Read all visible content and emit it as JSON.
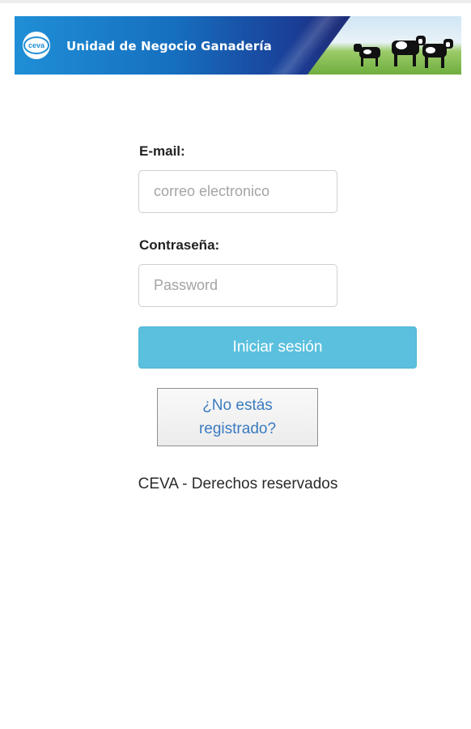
{
  "header": {
    "logo_text": "ceva",
    "title": "Unidad de Negocio Ganadería"
  },
  "form": {
    "email_label": "E-mail:",
    "email_placeholder": "correo electronico",
    "email_value": "",
    "password_label": "Contraseña:",
    "password_placeholder": "Password",
    "password_value": "",
    "login_button": "Iniciar sesión",
    "register_line1": "¿No estás",
    "register_line2": "registrado?"
  },
  "footer": {
    "text": "CEVA - Derechos reservados"
  },
  "colors": {
    "primary_button": "#5bc0de",
    "banner_blue": "#1f8fd6",
    "link_blue": "#3a7bc0"
  }
}
